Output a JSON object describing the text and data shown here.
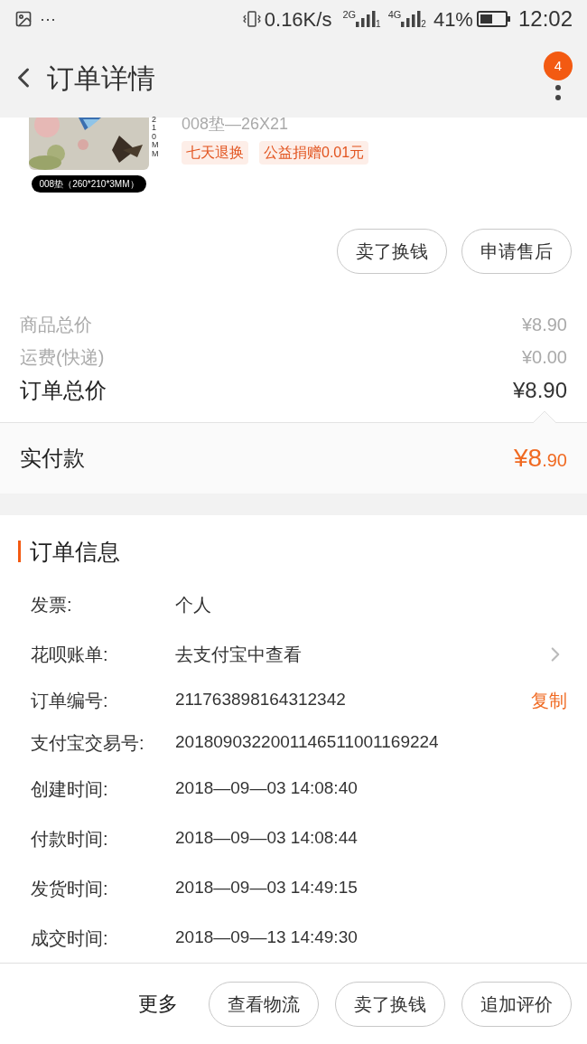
{
  "status_bar": {
    "dots": "···",
    "speed": "0.16K/s",
    "sim1_type": "2G",
    "sim1_index": "1",
    "sim2_type": "4G",
    "sim2_index": "2",
    "battery": "41%",
    "time": "12:02"
  },
  "header": {
    "title": "订单详情",
    "badge": "4"
  },
  "product": {
    "image_caption": "008垫（260*210*3MM）",
    "image_side_label": "210MM",
    "spec": "008垫—26X21",
    "tags": [
      "七天退换",
      "公益捐赠0.01元"
    ]
  },
  "item_actions": [
    "卖了换钱",
    "申请售后"
  ],
  "price_summary": [
    {
      "label": "商品总价",
      "value": "¥8.90",
      "kind": "minor"
    },
    {
      "label": "运费(快递)",
      "value": "¥0.00",
      "kind": "minor"
    },
    {
      "label": "订单总价",
      "value": "¥8.90",
      "kind": "total"
    }
  ],
  "paid": {
    "label": "实付款",
    "currency": "¥8",
    "cents": ".90"
  },
  "order_info": {
    "title": "订单信息",
    "rows": [
      {
        "label": "发票:",
        "value": "个人",
        "kind": "plain"
      },
      {
        "label": "花呗账单:",
        "value": "去支付宝中查看",
        "kind": "link"
      },
      {
        "label": "订单编号:",
        "value": "211763898164312342",
        "kind": "copy",
        "action": "复制"
      },
      {
        "label": "支付宝交易号:",
        "value": "2018090322001146511001169224",
        "kind": "plain"
      },
      {
        "label": "创建时间:",
        "value": "2018—09—03 14:08:40",
        "kind": "plain"
      },
      {
        "label": "付款时间:",
        "value": "2018—09—03 14:08:44",
        "kind": "plain"
      },
      {
        "label": "发货时间:",
        "value": "2018—09—03 14:49:15",
        "kind": "plain"
      },
      {
        "label": "成交时间:",
        "value": "2018—09—13 14:49:30",
        "kind": "plain"
      }
    ]
  },
  "bottom_bar": {
    "more": "更多",
    "buttons": [
      "查看物流",
      "卖了换钱",
      "追加评价"
    ]
  }
}
